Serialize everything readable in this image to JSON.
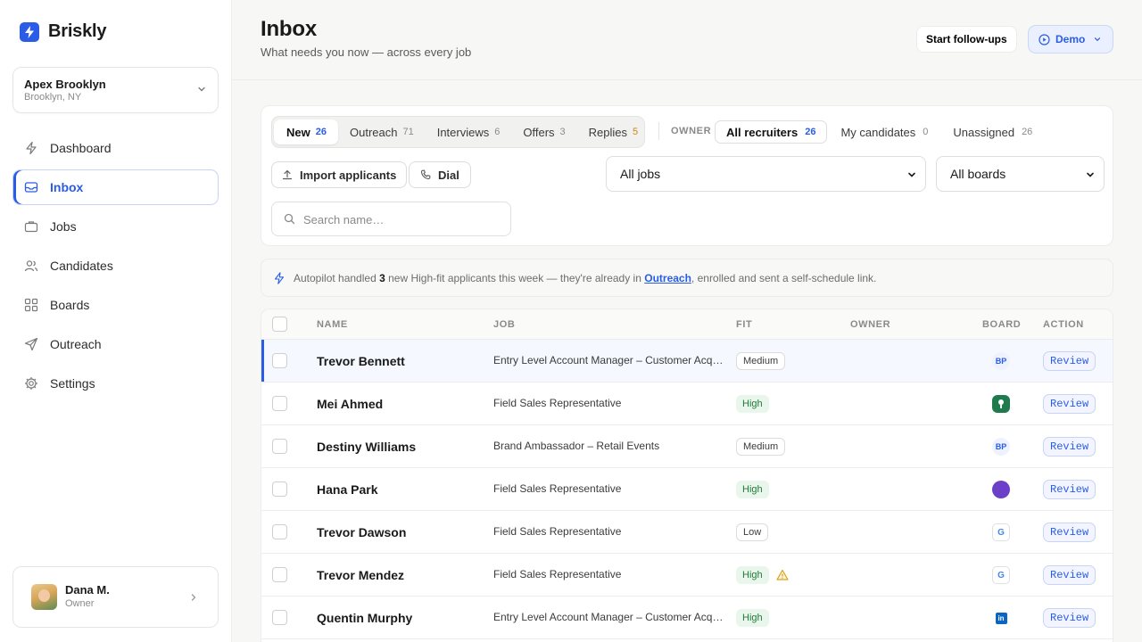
{
  "brand": {
    "name": "Briskly",
    "logo_icon": "bolt-icon",
    "accent": "#2b5ce6"
  },
  "workspace": {
    "name": "Apex Brooklyn",
    "location": "Brooklyn, NY"
  },
  "nav": {
    "items": [
      {
        "label": "Dashboard",
        "icon": "bolt-icon"
      },
      {
        "label": "Inbox",
        "icon": "inbox-icon",
        "active": true
      },
      {
        "label": "Jobs",
        "icon": "briefcase-icon"
      },
      {
        "label": "Candidates",
        "icon": "users-icon"
      },
      {
        "label": "Boards",
        "icon": "grid-icon"
      },
      {
        "label": "Outreach",
        "icon": "send-icon"
      },
      {
        "label": "Settings",
        "icon": "gear-icon"
      }
    ]
  },
  "user": {
    "name": "Dana M.",
    "role": "Owner"
  },
  "header": {
    "title": "Inbox",
    "subtitle": "What needs you now — across every job",
    "follow_label": "Start follow-ups",
    "demo_label": "Demo"
  },
  "stage_tabs": [
    {
      "label": "New",
      "count": "26",
      "active": true
    },
    {
      "label": "Outreach",
      "count": "71"
    },
    {
      "label": "Interviews",
      "count": "6"
    },
    {
      "label": "Offers",
      "count": "3"
    },
    {
      "label": "Replies",
      "count": "5"
    }
  ],
  "owner": {
    "label": "OWNER",
    "tabs": [
      {
        "label": "All recruiters",
        "count": "26",
        "active": true
      },
      {
        "label": "My candidates",
        "count": "0"
      },
      {
        "label": "Unassigned",
        "count": "26"
      }
    ]
  },
  "actions": {
    "import_label": "Import applicants",
    "dial_label": "Dial"
  },
  "filters": {
    "jobs_value": "All jobs",
    "boards_value": "All boards"
  },
  "search": {
    "placeholder": "Search name…"
  },
  "banner": {
    "prefix": "Autopilot handled",
    "count": "3",
    "middle": "new High-fit applicants this week — they're already in",
    "link": "Outreach",
    "suffix": ", enrolled and sent a self-schedule link."
  },
  "table": {
    "headers": {
      "name": "NAME",
      "job": "JOB",
      "fit": "FIT",
      "owner": "OWNER",
      "board": "BOARD",
      "action": "ACTION"
    },
    "rows": [
      {
        "name": "Trevor Bennett",
        "job": "Entry Level Account Manager – Customer Acq…",
        "fit": "Medium",
        "board": "BP",
        "action": "Review"
      },
      {
        "name": "Mei Ahmed",
        "job": "Field Sales Representative",
        "fit": "High",
        "board": "",
        "action": "Review"
      },
      {
        "name": "Destiny Williams",
        "job": "Brand Ambassador – Retail Events",
        "fit": "Medium",
        "board": "BP",
        "action": "Review"
      },
      {
        "name": "Hana Park",
        "job": "Field Sales Representative",
        "fit": "High",
        "board": "",
        "action": "Review"
      },
      {
        "name": "Trevor Dawson",
        "job": "Field Sales Representative",
        "fit": "Low",
        "board": "G",
        "action": "Review"
      },
      {
        "name": "Trevor Mendez",
        "job": "Field Sales Representative",
        "fit": "High",
        "board": "G",
        "action": "Review"
      },
      {
        "name": "Quentin Murphy",
        "job": "Entry Level Account Manager – Customer Acq…",
        "fit": "High",
        "board": "in",
        "action": "Review"
      }
    ]
  }
}
